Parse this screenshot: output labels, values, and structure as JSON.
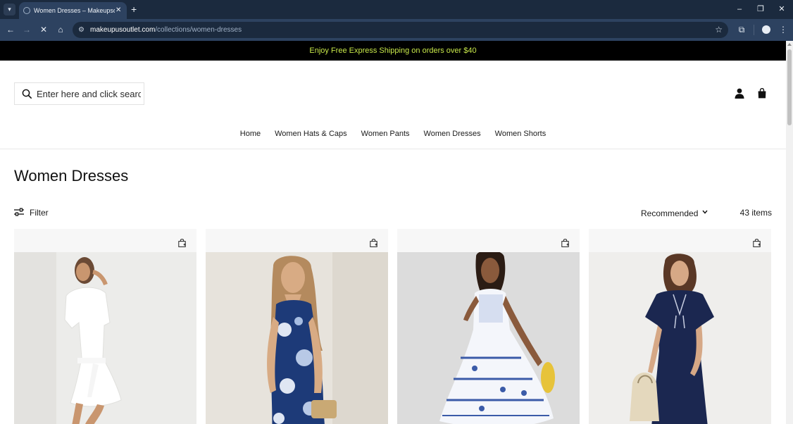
{
  "browser": {
    "tab_title": "Women Dresses – Makeupsoutlet",
    "url_host": "makeupusoutlet.com",
    "url_path": "/collections/women-dresses"
  },
  "page": {
    "announcement": "Enjoy Free Express Shipping on orders over $40",
    "search_placeholder": "Enter here and click search",
    "nav": [
      "Home",
      "Women Hats & Caps",
      "Women Pants",
      "Women Dresses",
      "Women Shorts"
    ],
    "title": "Women Dresses",
    "filter_label": "Filter",
    "sort_label": "Recommended",
    "item_count": "43 items",
    "products": [
      {
        "dress": "white",
        "background": "light"
      },
      {
        "dress": "navy-floral",
        "background": "beige"
      },
      {
        "dress": "blue-white-print",
        "background": "gray"
      },
      {
        "dress": "navy-maxi",
        "background": "light"
      }
    ]
  },
  "colors": {
    "announcement_text": "#c8e84a",
    "chrome_dark": "#1b2a3e",
    "chrome_mid": "#2d4260"
  }
}
